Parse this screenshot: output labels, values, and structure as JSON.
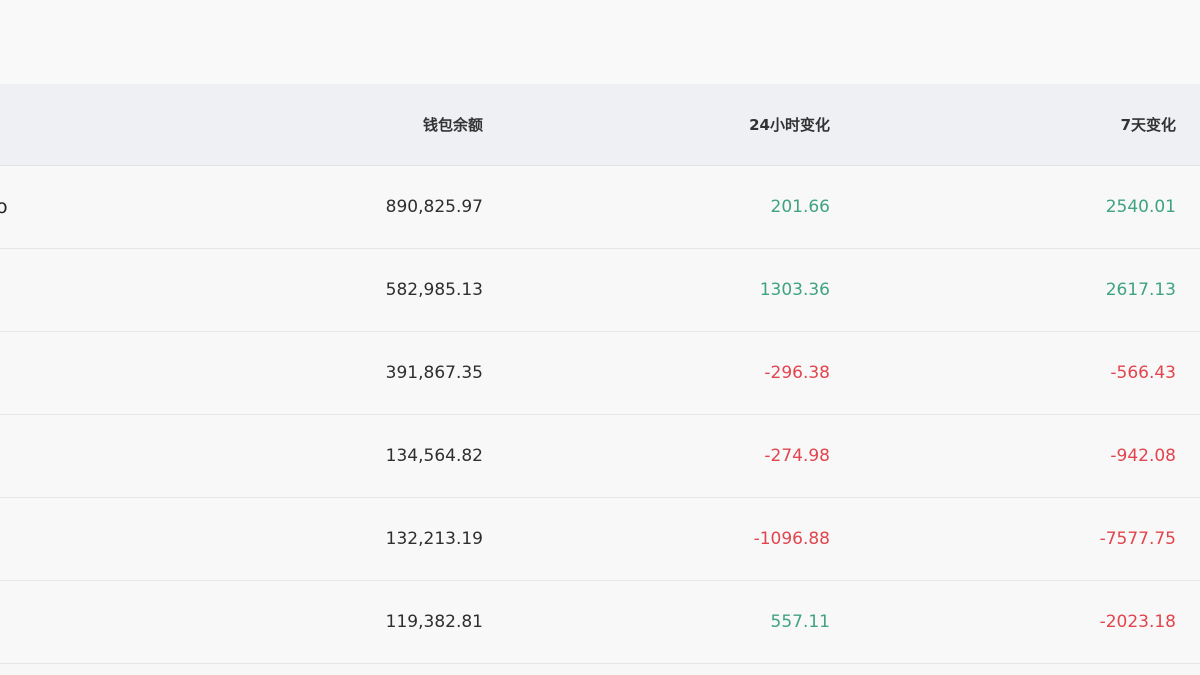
{
  "table": {
    "headers": {
      "balance": "钱包余额",
      "change_24h": "24小时变化",
      "change_7d": "7天变化"
    },
    "rows": [
      {
        "name": "o",
        "balance": "890,825.97",
        "change_24h": "201.66",
        "change_24h_trend": "positive",
        "change_7d": "2540.01",
        "change_7d_trend": "positive"
      },
      {
        "name": "",
        "balance": "582,985.13",
        "change_24h": "1303.36",
        "change_24h_trend": "positive",
        "change_7d": "2617.13",
        "change_7d_trend": "positive"
      },
      {
        "name": "",
        "balance": "391,867.35",
        "change_24h": "-296.38",
        "change_24h_trend": "negative",
        "change_7d": "-566.43",
        "change_7d_trend": "negative"
      },
      {
        "name": "",
        "balance": "134,564.82",
        "change_24h": "-274.98",
        "change_24h_trend": "negative",
        "change_7d": "-942.08",
        "change_7d_trend": "negative"
      },
      {
        "name": "",
        "balance": "132,213.19",
        "change_24h": "-1096.88",
        "change_24h_trend": "negative",
        "change_7d": "-7577.75",
        "change_7d_trend": "negative"
      },
      {
        "name": "",
        "balance": "119,382.81",
        "change_24h": "557.11",
        "change_24h_trend": "positive",
        "change_7d": "-2023.18",
        "change_7d_trend": "negative"
      }
    ]
  },
  "colors": {
    "positive": "#3fa381",
    "negative": "#e2454d",
    "header_bg": "#eef0f4",
    "row_bg": "#f8f8f9"
  }
}
